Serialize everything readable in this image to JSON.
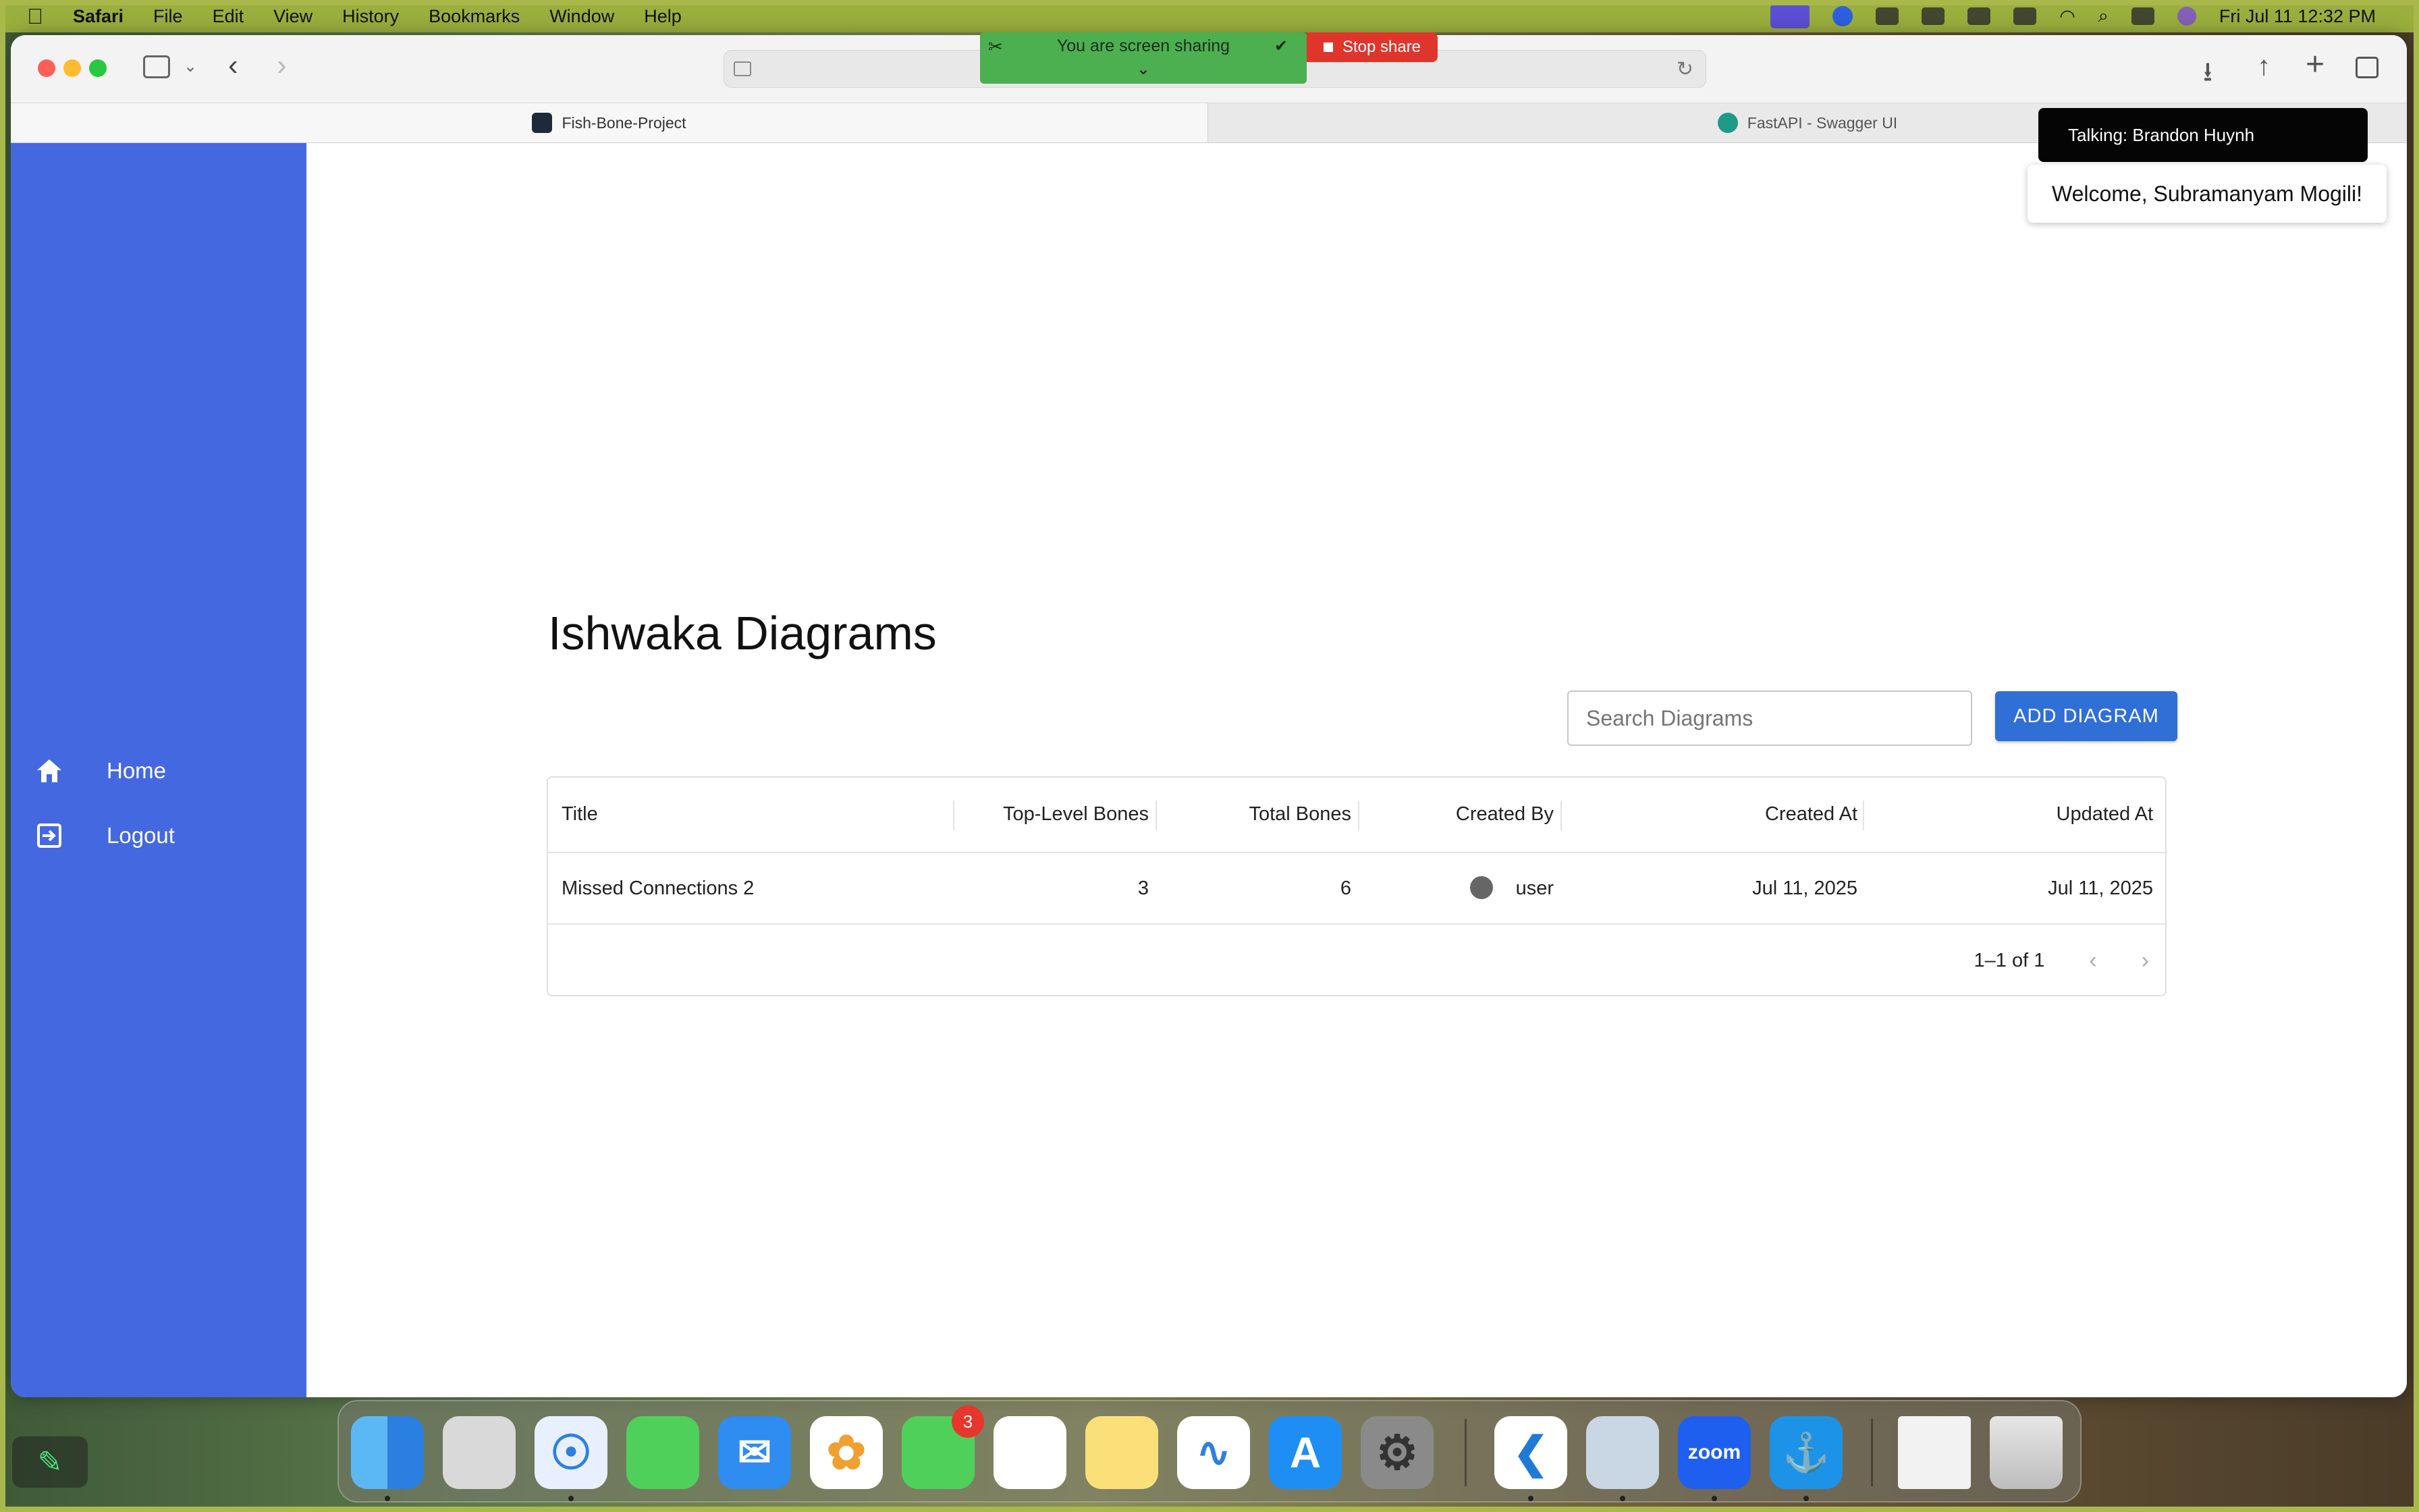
{
  "menubar": {
    "app_name": "Safari",
    "items": [
      "File",
      "Edit",
      "View",
      "History",
      "Bookmarks",
      "Window",
      "Help"
    ],
    "clock": "Fri Jul 11  12:32 PM"
  },
  "screen_share": {
    "status": "You are screen sharing",
    "stop_label": "Stop share"
  },
  "tabs": [
    {
      "label": "Fish-Bone-Project",
      "active": true
    },
    {
      "label": "FastAPI - Swagger UI",
      "active": false
    }
  ],
  "sidebar": {
    "items": [
      {
        "label": "Home",
        "icon": "home-icon"
      },
      {
        "label": "Logout",
        "icon": "logout-icon"
      }
    ]
  },
  "main": {
    "title": "Ishwaka Diagrams",
    "search_placeholder": "Search Diagrams",
    "add_label": "ADD DIAGRAM"
  },
  "table": {
    "columns": [
      "Title",
      "Top-Level Bones",
      "Total Bones",
      "Created By",
      "Created At",
      "Updated At"
    ],
    "rows": [
      {
        "title": "Missed Connections 2",
        "top_level_bones": "3",
        "total_bones": "6",
        "created_by": "user",
        "created_at": "Jul 11, 2025",
        "updated_at": "Jul 11, 2025"
      }
    ],
    "pagination": "1–1 of 1"
  },
  "zoom": {
    "talking": "Talking: Brandon Huynh",
    "welcome": "Welcome, Subramanyam Mogili!"
  },
  "dock": {
    "apps": [
      "Finder",
      "Launchpad",
      "Safari",
      "Messages",
      "Mail",
      "Photos",
      "FaceTime",
      "Reminders",
      "Notes",
      "Freeform",
      "App Store",
      "System Settings",
      "Visual Studio Code",
      "Preview",
      "Zoom",
      "Docker",
      "Zoom window",
      "Trash"
    ],
    "facetime_badge": "3",
    "zoom_label": "zoom"
  },
  "colors": {
    "sidebar": "#4468df",
    "button": "#2f6fd6",
    "share_green": "#4caf50",
    "stop_red": "#e0352b"
  }
}
